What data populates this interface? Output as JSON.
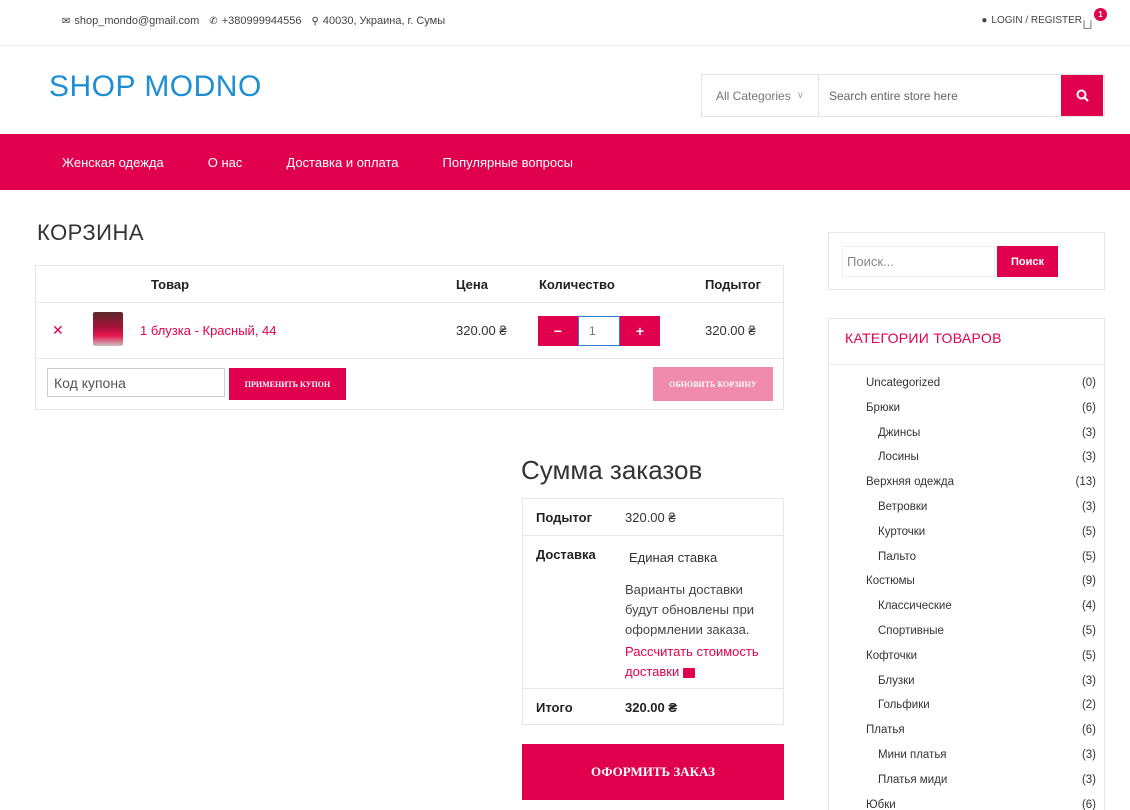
{
  "topbar": {
    "email": "shop_mondo@gmail.com",
    "phone": "+380999944556",
    "address": "40030, Украина, г. Сумы",
    "account_link": "LOGIN / REGISTER",
    "cart_count": "1"
  },
  "header": {
    "logo": "SHOP MODNO",
    "search": {
      "category": "All Categories",
      "placeholder": "Search entire store here"
    }
  },
  "nav": {
    "items": [
      "Женская одежда",
      "О нас",
      "Доставка и оплата",
      "Популярные вопросы"
    ]
  },
  "cart": {
    "title": "КОРЗИНА",
    "columns": {
      "product": "Товар",
      "price": "Цена",
      "quantity": "Количество",
      "subtotal": "Подытог"
    },
    "items": [
      {
        "name": "1 блузка - Красный, 44",
        "price": "320.00 ₴",
        "quantity": "1",
        "subtotal": "320.00 ₴"
      }
    ],
    "coupon_placeholder": "Код купона",
    "apply_coupon": "Применить купон",
    "update_cart": "Обновить корзину"
  },
  "totals": {
    "title": "Сумма заказов",
    "subtotal_label": "Подытог",
    "subtotal_value": "320.00 ₴",
    "shipping_label": "Доставка",
    "shipping_method": "Единая ставка",
    "shipping_note": "Варианты доставки будут обновлены при оформлении заказа.",
    "calc_shipping": "Рассчитать стоимость доставки",
    "total_label": "Итого",
    "total_value": "320.00 ₴",
    "checkout": "Оформить заказ"
  },
  "sidebar": {
    "search_placeholder": "Поиск...",
    "search_button": "Поиск",
    "categories_title": "КАТЕГОРИИ ТОВАРОВ",
    "categories": [
      {
        "name": "Uncategorized",
        "count": "(0)",
        "sub": false
      },
      {
        "name": "Брюки",
        "count": "(6)",
        "sub": false
      },
      {
        "name": "Джинсы",
        "count": "(3)",
        "sub": true
      },
      {
        "name": "Лосины",
        "count": "(3)",
        "sub": true
      },
      {
        "name": "Верхняя одежда",
        "count": "(13)",
        "sub": false
      },
      {
        "name": "Ветровки",
        "count": "(3)",
        "sub": true
      },
      {
        "name": "Курточки",
        "count": "(5)",
        "sub": true
      },
      {
        "name": "Пальто",
        "count": "(5)",
        "sub": true
      },
      {
        "name": "Костюмы",
        "count": "(9)",
        "sub": false
      },
      {
        "name": "Классические",
        "count": "(4)",
        "sub": true
      },
      {
        "name": "Спортивные",
        "count": "(5)",
        "sub": true
      },
      {
        "name": "Кофточки",
        "count": "(5)",
        "sub": false
      },
      {
        "name": "Блузки",
        "count": "(3)",
        "sub": true
      },
      {
        "name": "Гольфики",
        "count": "(2)",
        "sub": true
      },
      {
        "name": "Платья",
        "count": "(6)",
        "sub": false
      },
      {
        "name": "Мини платья",
        "count": "(3)",
        "sub": true
      },
      {
        "name": "Платья миди",
        "count": "(3)",
        "sub": true
      },
      {
        "name": "Юбки",
        "count": "(6)",
        "sub": false
      }
    ]
  },
  "colors": {
    "accent": "#e0004d",
    "logo": "#1e8fd3",
    "update_button": "#f08bae"
  }
}
